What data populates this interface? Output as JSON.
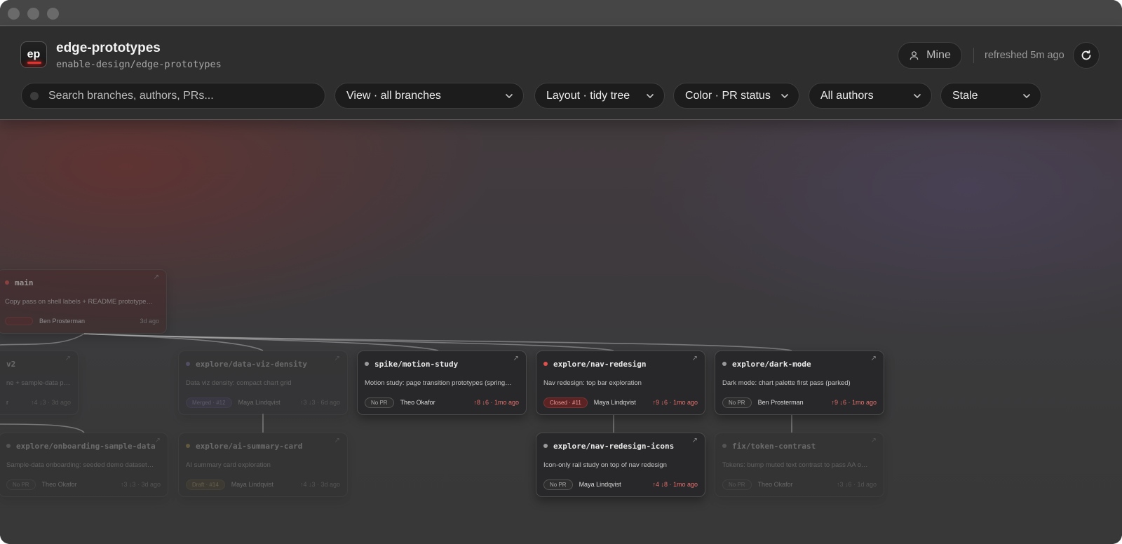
{
  "app": {
    "icon_text": "ep",
    "repo_name": "edge-prototypes",
    "repo_path": "enable-design/edge-prototypes"
  },
  "toolbar": {
    "mine_label": "Mine",
    "refreshed_text": "refreshed 5m ago",
    "search_placeholder": "Search branches, authors, PRs...",
    "filters": {
      "view": "View · all branches",
      "layout": "Layout · tidy tree",
      "color": "Color · PR status",
      "authors": "All authors",
      "stale": "Stale"
    }
  },
  "colors": {
    "dot_main": "#d24a47",
    "dot_default": "#9a9a9a",
    "dot_nav_redesign": "#e0504c",
    "dot_ai_summary": "#c9a84a",
    "dot_data_viz": "#8a86c8",
    "hot": "#e5706d"
  },
  "cards": {
    "main": {
      "name": "main",
      "desc": "Copy pass on shell labels + README prototype…",
      "pill": "",
      "author": "Ben Prosterman",
      "stats": "3d ago"
    },
    "v2": {
      "name": "v2",
      "desc": "ne + sample-data path",
      "pill": "",
      "author": "r",
      "stats": "↑4 ↓3 · 3d ago"
    },
    "data_viz": {
      "name": "explore/data-viz-density",
      "desc": "Data viz density: compact chart grid",
      "pill": "Merged · #12",
      "author": "Maya Lindqvist",
      "stats": "↑3 ↓3 · 6d ago"
    },
    "motion": {
      "name": "spike/motion-study",
      "desc": "Motion study: page transition prototypes (spring…",
      "pill": "No PR",
      "author": "Theo Okafor",
      "stats_hot": "↑8 ↓6",
      "stats_rest": " · 1mo ago"
    },
    "nav_redesign": {
      "name": "explore/nav-redesign",
      "desc": "Nav redesign: top bar exploration",
      "pill": "Closed · #11",
      "author": "Maya Lindqvist",
      "stats_hot": "↑9 ↓6",
      "stats_rest": " · 1mo ago"
    },
    "dark_mode": {
      "name": "explore/dark-mode",
      "desc": "Dark mode: chart palette first pass (parked)",
      "pill": "No PR",
      "author": "Ben Prosterman",
      "stats_hot": "↑9 ↓6",
      "stats_rest": " · 1mo ago"
    },
    "onboarding": {
      "name": "explore/onboarding-sample-data",
      "desc": "Sample-data onboarding: seeded demo dataset…",
      "pill": "No PR",
      "author": "Theo Okafor",
      "stats": "↑3 ↓3 · 3d ago"
    },
    "ai_summary": {
      "name": "explore/ai-summary-card",
      "desc": "AI summary card exploration",
      "pill": "Draft · #14",
      "author": "Maya Lindqvist",
      "stats": "↑4 ↓3 · 3d ago"
    },
    "nav_icons": {
      "name": "explore/nav-redesign-icons",
      "desc": "Icon-only rail study on top of nav redesign",
      "pill": "No PR",
      "author": "Maya Lindqvist",
      "stats_hot": "↑4 ↓8",
      "stats_rest": " · 1mo ago"
    },
    "token_contrast": {
      "name": "fix/token-contrast",
      "desc": "Tokens: bump muted text contrast to pass AA o…",
      "pill": "No PR",
      "author": "Theo Okafor",
      "stats": "↑3 ↓6 · 1d ago"
    }
  }
}
